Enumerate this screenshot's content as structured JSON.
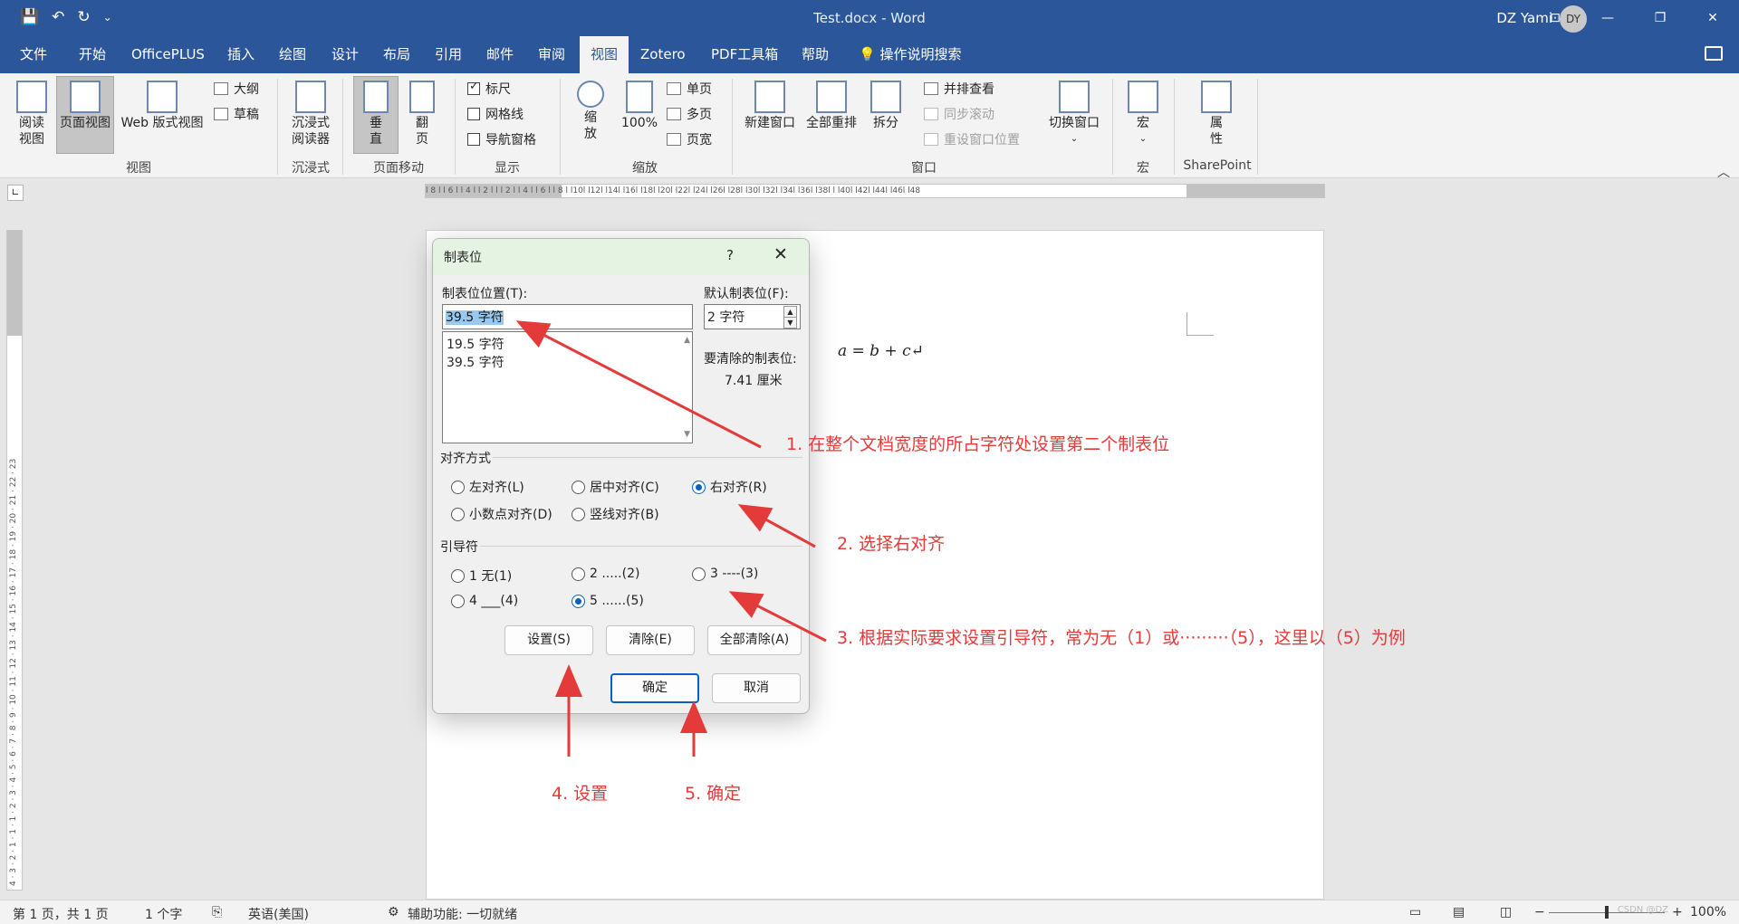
{
  "qat": {
    "save_icon": "💾",
    "undo_icon": "↶",
    "redo_icon": "↻",
    "more_icon": "⌄"
  },
  "titlebar": {
    "title": "Test.docx  -  Word",
    "user": "DZ Yami",
    "avatar": "DY",
    "controls": [
      "⊡",
      "—",
      "❐",
      "✕"
    ]
  },
  "tabs": [
    "文件",
    "开始",
    "OfficePLUS",
    "插入",
    "绘图",
    "设计",
    "布局",
    "引用",
    "邮件",
    "审阅",
    "视图",
    "Zotero",
    "PDF工具箱",
    "帮助"
  ],
  "active_tab": "视图",
  "tell_me": "操作说明搜索",
  "ribbon": {
    "view_group": {
      "label": "视图",
      "read": "阅读\n视图",
      "print": "页面视图",
      "web": "Web 版式视图",
      "outline": "大纲",
      "draft": "草稿"
    },
    "immersive_group": {
      "label": "沉浸式",
      "reader": "沉浸式\n阅读器"
    },
    "page_move_group": {
      "label": "页面移动",
      "vertical": "垂\n直",
      "side": "翻\n页"
    },
    "show_group": {
      "label": "显示",
      "ruler": "标尺",
      "gridlines": "网格线",
      "nav": "导航窗格",
      "ruler_checked": true,
      "gridlines_checked": false,
      "nav_checked": false
    },
    "zoom_group": {
      "label": "缩放",
      "zoom": "缩\n放",
      "hundred": "100%",
      "one_page": "单页",
      "multi_page": "多页",
      "page_width": "页宽"
    },
    "window_group": {
      "label": "窗口",
      "new_window": "新建窗口",
      "arrange_all": "全部重排",
      "split": "拆分",
      "side_by_side": "并排查看",
      "sync_scroll": "同步滚动",
      "reset_pos": "重设窗口位置",
      "switch": "切换窗口"
    },
    "macro_group": {
      "label": "宏",
      "macro": "宏"
    },
    "sp_group": {
      "label": "SharePoint",
      "props": "属\n性"
    }
  },
  "ruler": {
    "h_text": "l 8 l  l 6 l  l 4 l  l 2 l  l     l 2 l  l 4 l  l 6 l  l 8 l  l10l  l12l  l14l  l16l  l18l  l20l  l22l  l24l  l26l  l28l  l30l  l32l  l34l  l36l  l38l  l  l40l  l42l  l44l  l46l  l48",
    "v_text": "4 · 3 · 2 · 1 · 1 · 1 · 2 · 3 · 4 · 5 · 6 · 7 · 8 · 9 · 10 · 11 · 12 · 13 · 14 · 15 · 16 · 17 · 18 · 19 · 20 · 21 · 22 · 23"
  },
  "document": {
    "formula": "a = b + c↵"
  },
  "dialog": {
    "title": "制表位",
    "help": "?",
    "close": "✕",
    "pos_label": "制表位位置(T):",
    "pos_value": "39.5 字符",
    "list": [
      "19.5 字符",
      "39.5 字符"
    ],
    "default_label": "默认制表位(F):",
    "default_value": "2 字符",
    "clear_label": "要清除的制表位:",
    "clear_value": "7.41 厘米",
    "align_label": "对齐方式",
    "align": [
      "左对齐(L)",
      "居中对齐(C)",
      "右对齐(R)",
      "小数点对齐(D)",
      "竖线对齐(B)"
    ],
    "align_selected": "右对齐(R)",
    "leader_label": "引导符",
    "leader": [
      "1 无(1)",
      "2 .....(2)",
      "3 ----(3)",
      "4 ___(4)",
      "5 ......(5)"
    ],
    "leader_selected": "5 ......(5)",
    "btn_set": "设置(S)",
    "btn_clear": "清除(E)",
    "btn_clear_all": "全部清除(A)",
    "btn_ok": "确定",
    "btn_cancel": "取消"
  },
  "annotations": {
    "n1": "1. 在整个文档宽度的所占字符处设置第二个制表位",
    "n2": "2. 选择右对齐",
    "n3": "3. 根据实际要求设置引导符，常为无（1）或·········（5），这里以（5）为例",
    "n4": "4. 设置",
    "n5": "5. 确定",
    "color": "#e43a3a"
  },
  "status": {
    "page": "第 1 页，共 1 页",
    "words": "1 个字",
    "lang": "英语(美国)",
    "access": "辅助功能: 一切就绪",
    "zoom": "100%",
    "watermark": "CSDN @DZ"
  }
}
